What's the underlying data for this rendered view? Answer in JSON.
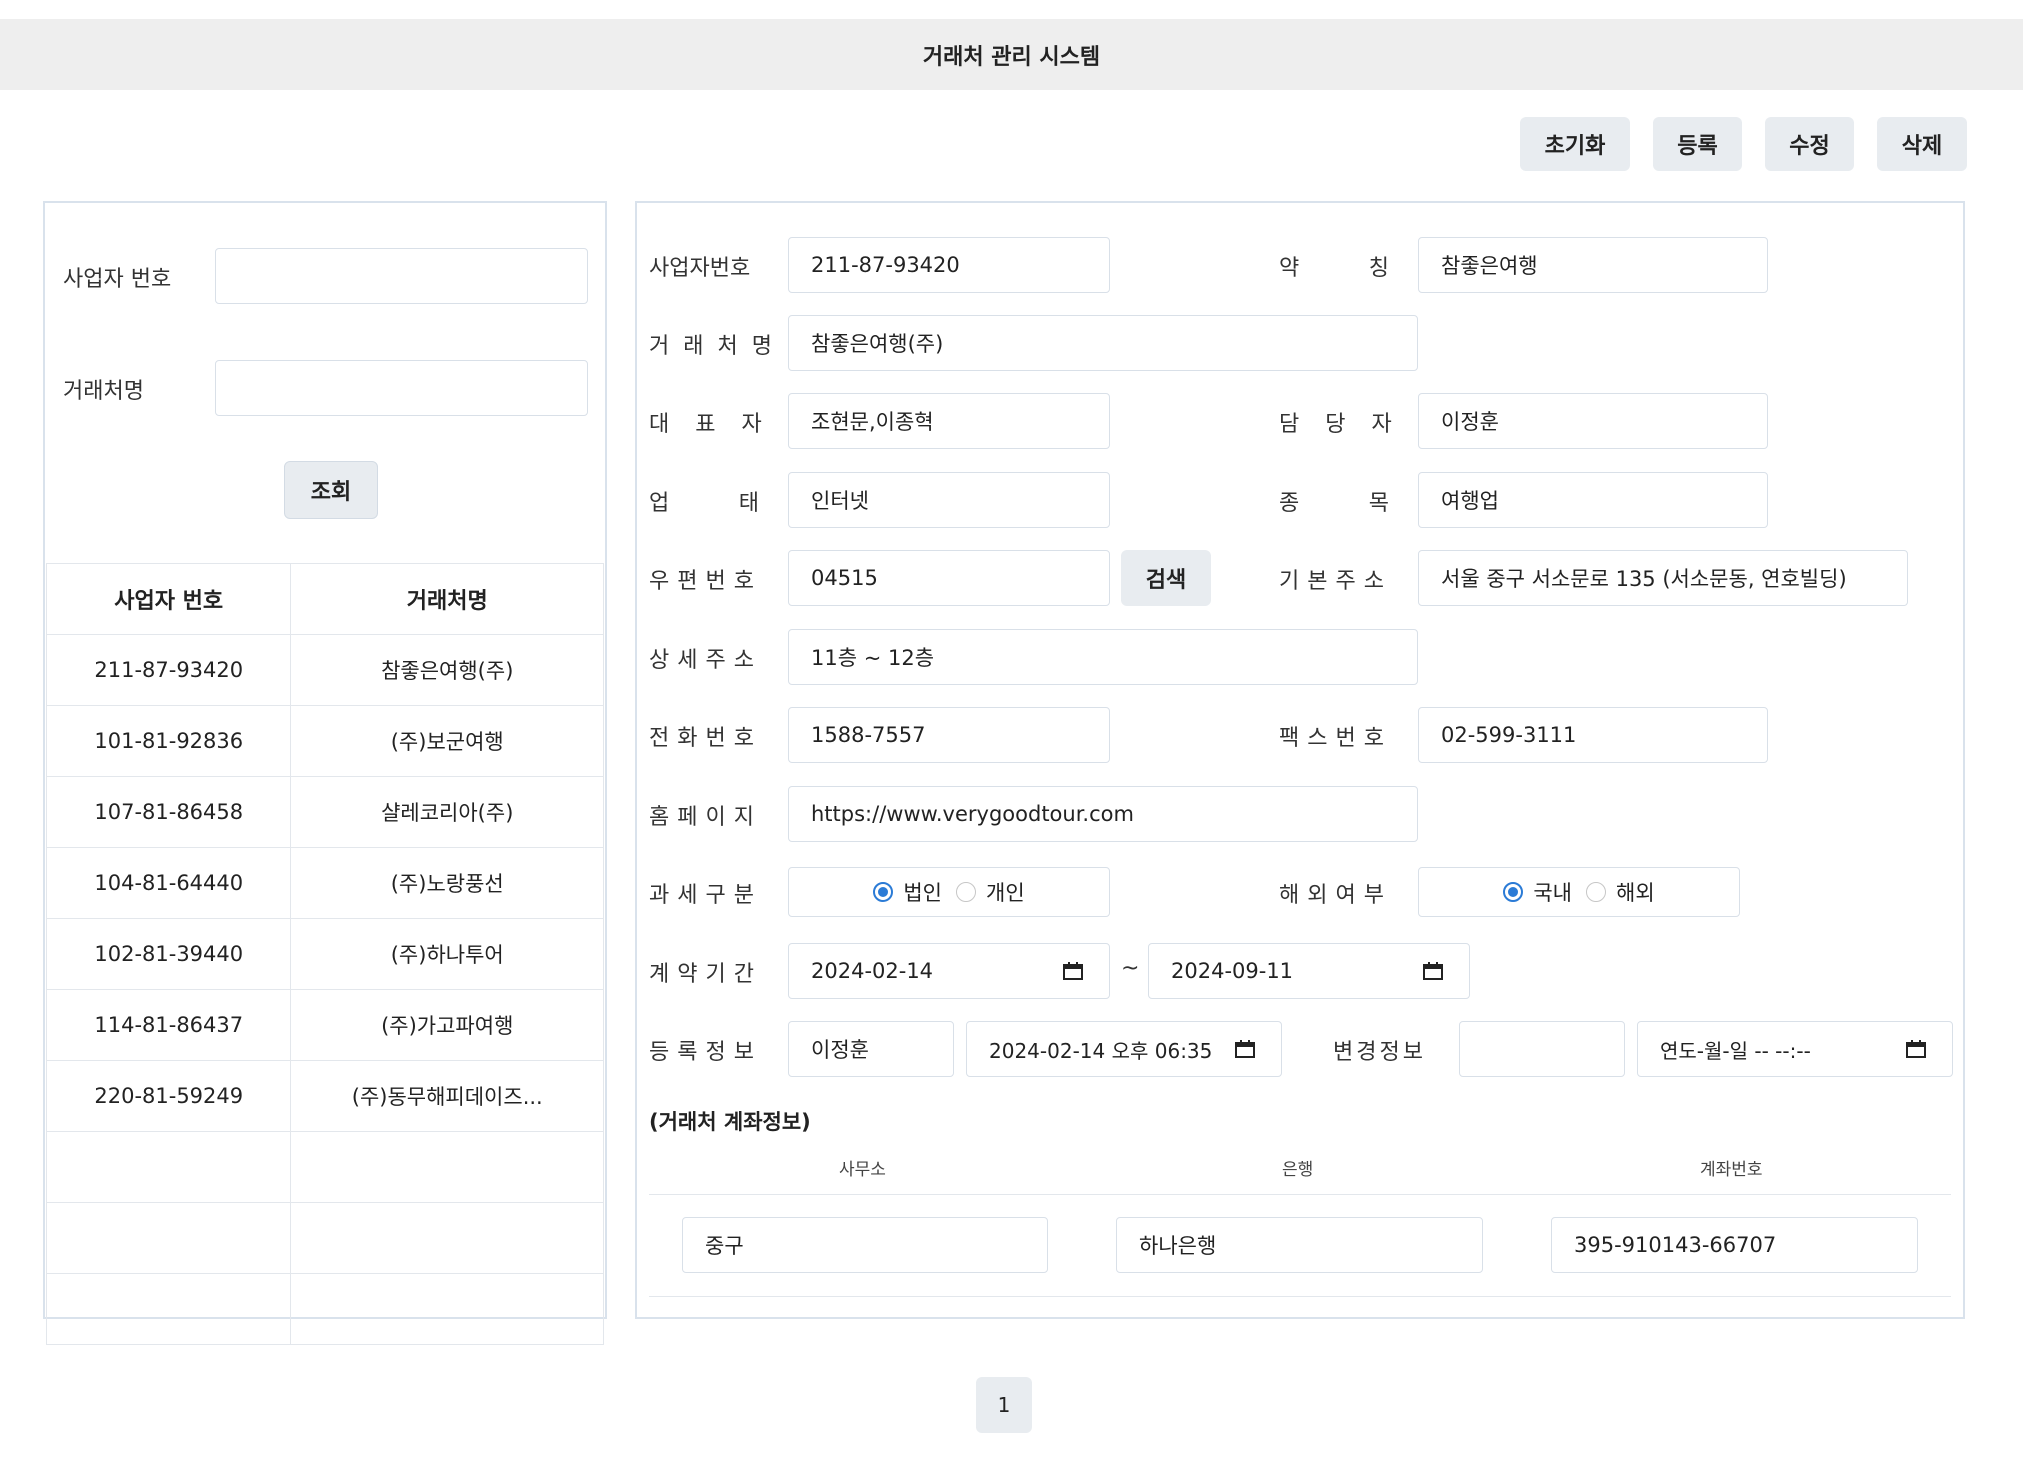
{
  "app_title": "거래처 관리 시스템",
  "toolbar": {
    "reset": "초기화",
    "register": "등록",
    "edit": "수정",
    "delete": "삭제"
  },
  "search": {
    "biz_no_label": "사업자 번호",
    "biz_no_value": "",
    "name_label": "거래처명",
    "name_value": "",
    "query_button": "조회"
  },
  "list": {
    "headers": [
      "사업자 번호",
      "거래처명"
    ],
    "rows": [
      [
        "211-87-93420",
        "참좋은여행(주)"
      ],
      [
        "101-81-92836",
        "(주)보군여행"
      ],
      [
        "107-81-86458",
        "샬레코리아(주)"
      ],
      [
        "104-81-64440",
        "(주)노랑풍선"
      ],
      [
        "102-81-39440",
        "(주)하나투어"
      ],
      [
        "114-81-86437",
        "(주)가고파여행"
      ],
      [
        "220-81-59249",
        "(주)동무해피데이즈..."
      ],
      [
        "",
        ""
      ],
      [
        "",
        ""
      ],
      [
        "",
        ""
      ]
    ]
  },
  "detail": {
    "biz_no_label": "사업자번호",
    "biz_no": "211-87-93420",
    "short_label": "약 칭",
    "short_name": "참좋은여행",
    "name_label": "거래처명",
    "name": "참좋은여행(주)",
    "ceo_label": "대표자",
    "ceo": "조현문,이종혁",
    "manager_label": "담당자",
    "manager": "이정훈",
    "biz_type_label": "업 태",
    "biz_type": "인터넷",
    "biz_item_label": "종 목",
    "biz_item": "여행업",
    "zip_label": "우편번호",
    "zip": "04515",
    "zip_search": "검색",
    "addr_label": "기본주소",
    "addr": "서울 중구 서소문로 135 (서소문동, 연호빌딩)",
    "addr_detail_label": "상세주소",
    "addr_detail": "11층 ~ 12층",
    "tel_label": "전화번호",
    "tel": "1588-7557",
    "fax_label": "팩스번호",
    "fax": "02-599-3111",
    "homepage_label": "홈페이지",
    "homepage": "https://www.verygoodtour.com",
    "tax_label": "과세구분",
    "tax_opt1": "법인",
    "tax_opt2": "개인",
    "tax_selected": "법인",
    "overseas_label": "해외여부",
    "ov_opt1": "국내",
    "ov_opt2": "해외",
    "ov_selected": "국내",
    "contract_label": "계약기간",
    "contract_from": "2024-02-14",
    "contract_sep": "~",
    "contract_to": "2024-09-11",
    "reg_label": "등록정보",
    "reg_user": "이정훈",
    "reg_date": "2024-02-14 오후 06:35",
    "mod_label": "변경정보",
    "mod_user": "",
    "mod_date": "연도-월-일 -- --:--"
  },
  "account": {
    "section_title": "(거래처 계좌정보)",
    "headers": [
      "사무소",
      "은행",
      "계좌번호"
    ],
    "office": "중구",
    "bank": "하나은행",
    "account_no": "395-910143-66707"
  },
  "pagination": {
    "current": "1"
  }
}
